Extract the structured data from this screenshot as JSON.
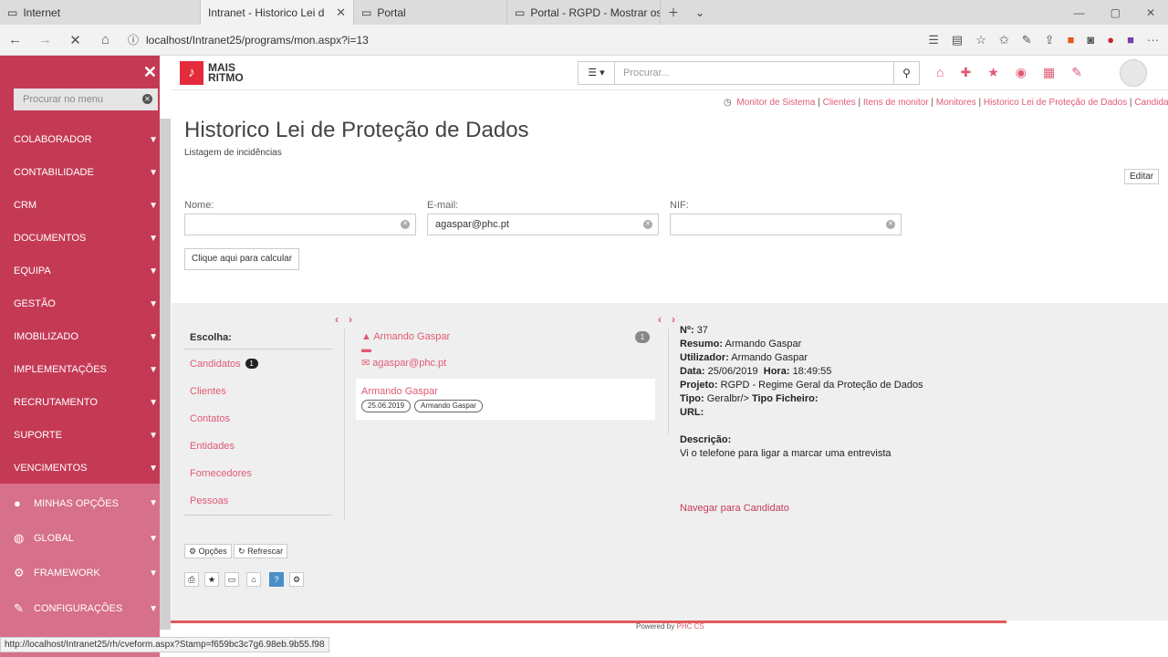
{
  "browser": {
    "tabs": [
      {
        "title": "Internet",
        "icon": "page-icon"
      },
      {
        "title": "Intranet - Historico Lei d",
        "icon": "page-icon"
      },
      {
        "title": "Portal",
        "icon": "page-icon"
      },
      {
        "title": "Portal - RGPD - Mostrar os d",
        "icon": "page-icon"
      }
    ],
    "url": "localhost/Intranet25/programs/mon.aspx?i=13"
  },
  "sidebar": {
    "search_placeholder": "Procurar no menu",
    "items": [
      {
        "label": "COLABORADOR"
      },
      {
        "label": "CONTABILIDADE"
      },
      {
        "label": "CRM"
      },
      {
        "label": "DOCUMENTOS"
      },
      {
        "label": "EQUIPA"
      },
      {
        "label": "GESTÃO"
      },
      {
        "label": "IMOBILIZADO"
      },
      {
        "label": "IMPLEMENTAÇÕES"
      },
      {
        "label": "RECRUTAMENTO"
      },
      {
        "label": "SUPORTE"
      },
      {
        "label": "VENCIMENTOS"
      }
    ],
    "lower_items": [
      {
        "label": "MINHAS OPÇÕES",
        "icon": "user-icon"
      },
      {
        "label": "GLOBAL",
        "icon": "globe-icon"
      },
      {
        "label": "FRAMEWORK",
        "icon": "gears-icon"
      },
      {
        "label": "CONFIGURAÇÕES",
        "icon": "wrench-icon"
      }
    ]
  },
  "header": {
    "logo_line1": "MAIS",
    "logo_line2": "RITMO",
    "search_placeholder": "Procurar..."
  },
  "breadcrumb": [
    "Monitor de Sistema",
    "Clientes",
    "Itens de monitor",
    "Monitores",
    "Historico Lei de Proteção de Dados",
    "Candidatos"
  ],
  "page": {
    "title": "Historico Lei de Proteção de Dados",
    "subtitle": "Listagem de incidências",
    "edit_label": "Editar"
  },
  "form": {
    "name_label": "Nome:",
    "name_value": "",
    "email_label": "E-mail:",
    "email_value": "agaspar@phc.pt",
    "nif_label": "NIF:",
    "nif_value": "",
    "calc_label": "Clique aqui para calcular"
  },
  "choices": {
    "heading": "Escolha:",
    "items": [
      {
        "label": "Candidatos",
        "count": "1"
      },
      {
        "label": "Clientes"
      },
      {
        "label": "Contatos"
      },
      {
        "label": "Entidades"
      },
      {
        "label": "Fornecedores"
      },
      {
        "label": "Pessoas"
      }
    ]
  },
  "person": {
    "name": "Armando Gaspar",
    "email": "agaspar@phc.pt",
    "count": "1",
    "item_name": "Armando Gaspar",
    "item_date": "25.06.2019",
    "item_user": "Armando Gaspar"
  },
  "detail": {
    "num_label": "Nº:",
    "num": "37",
    "resumo_label": "Resumo:",
    "resumo": "Armando Gaspar",
    "user_label": "Utilizador:",
    "user": "Armando Gaspar",
    "date_label": "Data:",
    "date": "25/06/2019",
    "time_label": "Hora:",
    "time": "18:49:55",
    "project_label": "Projeto:",
    "project": "RGPD - Regime Geral da Proteção de Dados",
    "tipo_label": "Tipo:",
    "tipo": "Geralbr/>",
    "tipo_file_label": "Tipo Ficheiro:",
    "url_label": "URL:",
    "desc_label": "Descrição:",
    "desc": "Vi o telefone para ligar a marcar uma entrevista",
    "nav_link": "Navegar para Candidato"
  },
  "actions": {
    "options_label": "Opções",
    "refresh_label": "Refrescar"
  },
  "footer": {
    "powered_prefix": "Powered by",
    "powered_brand": "PHC CS"
  },
  "status_url": "http://localhost/Intranet25/rh/cveform.aspx?Stamp=f659bc3c7g6.98eb.9b55.f98",
  "colors": {
    "brand": "#c43a55",
    "accent": "#e05a74"
  }
}
